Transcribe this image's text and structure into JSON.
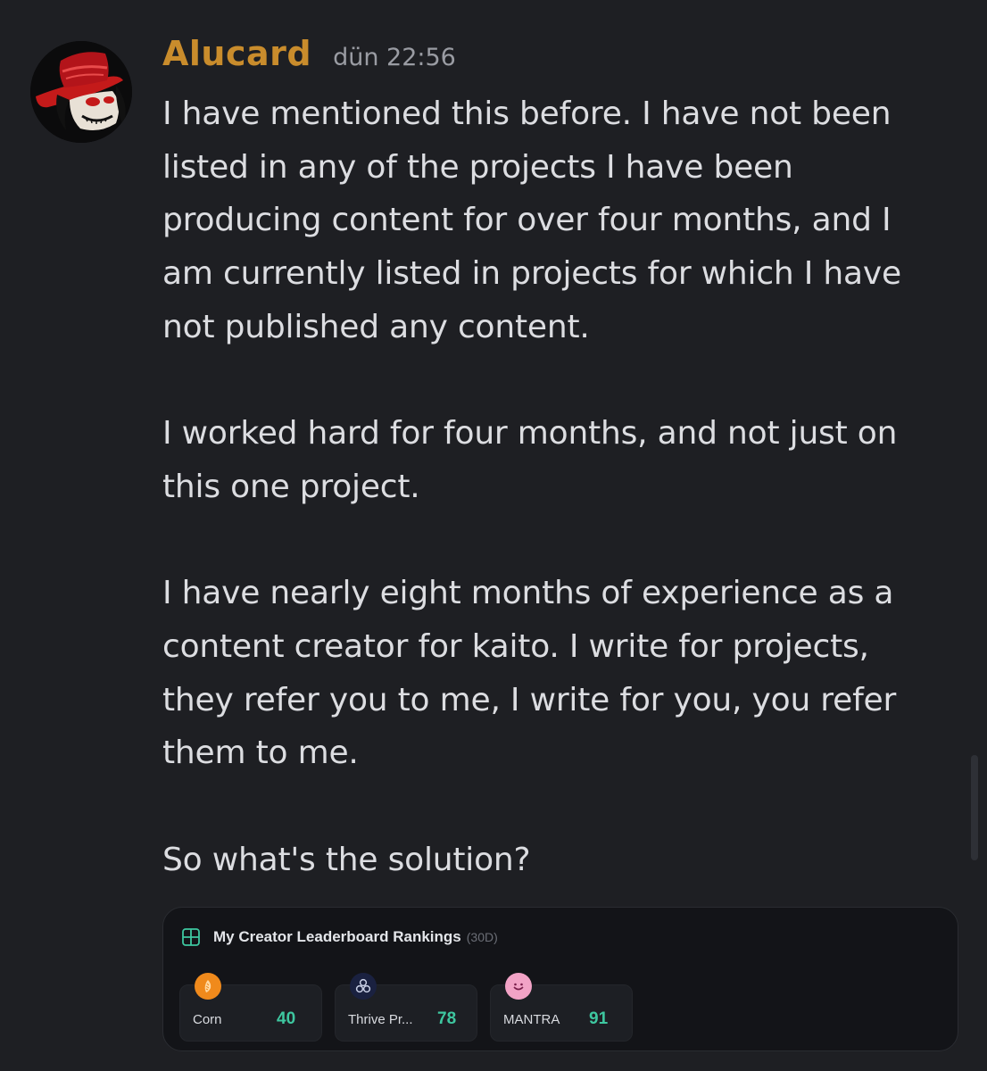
{
  "message": {
    "username": "Alucard",
    "timestamp": "dün 22:56",
    "paragraphs": [
      [
        "I have mentioned this before. I have not been",
        "listed in any of the projects I have been",
        "producing content for over four months, and I",
        "am currently listed in projects for which I have",
        "not published any content."
      ],
      [
        "I worked hard for four months, and not just on",
        "this one project."
      ],
      [
        "I have nearly eight months of experience as a",
        "content creator for kaito. I write for projects,",
        "they refer you to me, I write for you, you refer",
        "them to me."
      ],
      [
        "So what's the solution?"
      ]
    ]
  },
  "embed": {
    "title": "My Creator Leaderboard Rankings",
    "period": "(30D)",
    "rankings": [
      {
        "name": "Corn",
        "score": "40",
        "logo_icon": "corn-logo-icon",
        "logo_color": "#f08a1c"
      },
      {
        "name": "Thrive Pr...",
        "score": "78",
        "logo_icon": "thrive-logo-icon",
        "logo_color": "#1a2140"
      },
      {
        "name": "MANTRA",
        "score": "91",
        "logo_icon": "mantra-logo-icon",
        "logo_color": "#f2a3c6"
      }
    ]
  },
  "colors": {
    "background": "#1e1f23",
    "username": "#c98c2c",
    "text": "#dcdde1",
    "score": "#3ec7a0"
  }
}
